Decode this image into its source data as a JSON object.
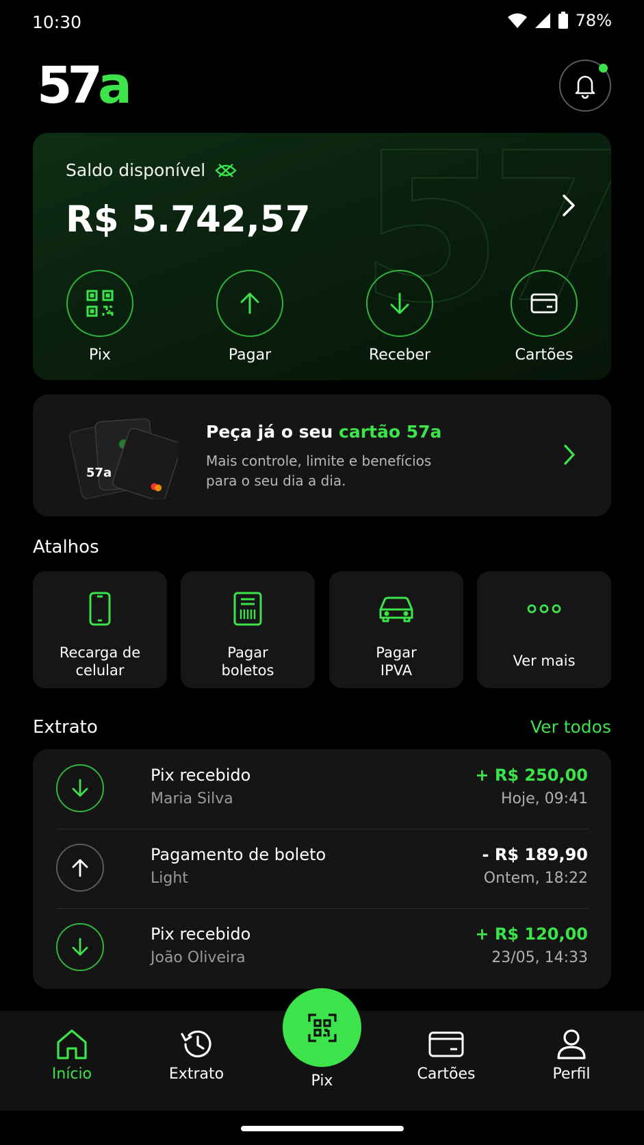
{
  "status_bar": {
    "time": "10:30",
    "battery": "78%"
  },
  "header": {
    "logo_digits": "57",
    "logo_letter": "a"
  },
  "balance": {
    "label": "Saldo disponível",
    "value": "R$ 5.742,57",
    "actions": [
      {
        "label": "Pix",
        "icon": "qr-code-icon"
      },
      {
        "label": "Pagar",
        "icon": "arrow-up-icon"
      },
      {
        "label": "Receber",
        "icon": "arrow-down-icon"
      },
      {
        "label": "Cartões",
        "icon": "card-icon"
      }
    ]
  },
  "promo": {
    "title_prefix": "Peça já o seu ",
    "title_highlight": "cartão 57a",
    "subtitle": "Mais controle, limite e benefícios para o seu dia a dia."
  },
  "shortcuts": {
    "heading": "Atalhos",
    "items": [
      {
        "line1": "Recarga de",
        "line2": "celular",
        "icon": "phone-icon"
      },
      {
        "line1": "Pagar",
        "line2": "boletos",
        "icon": "barcode-icon"
      },
      {
        "line1": "Pagar",
        "line2": "IPVA",
        "icon": "car-icon"
      },
      {
        "line1": "Ver mais",
        "line2": "",
        "icon": "more-icon"
      }
    ]
  },
  "statement": {
    "heading": "Extrato",
    "see_all": "Ver todos",
    "transactions": [
      {
        "title": "Pix recebido",
        "party": "Maria Silva",
        "amount": "+ R$ 250,00",
        "date": "Hoje, 09:41",
        "direction": "in"
      },
      {
        "title": "Pagamento de boleto",
        "party": "Light",
        "amount": "- R$ 189,90",
        "date": "Ontem, 18:22",
        "direction": "out"
      },
      {
        "title": "Pix recebido",
        "party": "João Oliveira",
        "amount": "+ R$ 120,00",
        "date": "23/05, 14:33",
        "direction": "in"
      }
    ]
  },
  "bottom_nav": {
    "items": [
      {
        "label": "Início",
        "icon": "home-icon",
        "active": true
      },
      {
        "label": "Extrato",
        "icon": "history-icon"
      },
      {
        "label": "Pix",
        "icon": "qr-scan-icon"
      },
      {
        "label": "Cartões",
        "icon": "card-icon"
      },
      {
        "label": "Perfil",
        "icon": "user-icon"
      }
    ]
  },
  "colors": {
    "accent": "#3ce34a",
    "background": "#000000",
    "card": "#151515",
    "balance_card": "#0e2e14"
  }
}
